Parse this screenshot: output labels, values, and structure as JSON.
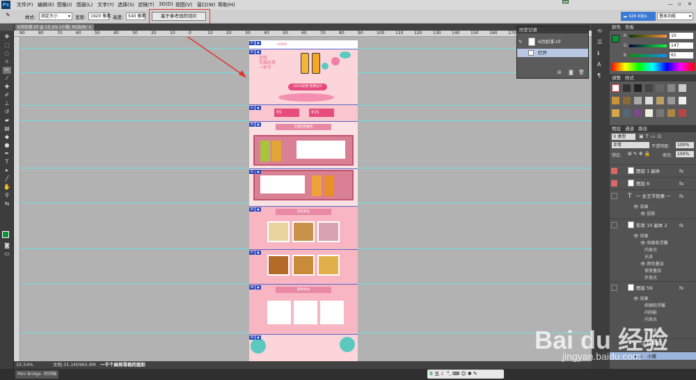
{
  "app": {
    "logo": "Ps"
  },
  "menu": [
    "文件(F)",
    "编辑(E)",
    "图像(I)",
    "图层(L)",
    "文字(Y)",
    "选择(S)",
    "滤镜(T)",
    "3D(D)",
    "视图(V)",
    "窗口(W)",
    "帮助(H)"
  ],
  "options": {
    "style_label": "样式:",
    "style_value": "固定大小",
    "width_label": "宽度:",
    "width_value": "1920 像素",
    "height_label": "高度:",
    "height_value": "540 像素",
    "slice_button": "基于参考线的切片"
  },
  "top_right": {
    "speed": "426 KB/s",
    "workspace": "基本功能"
  },
  "document": {
    "tab_title": "6月奶茶.tif @ 15.5% (小猪, RGB/8)",
    "zoom": "15.54%",
    "doc_info": "文档:31.1M/965.8M",
    "status_text": "一干个麻将哥格的面彩"
  },
  "ruler_numbers": [
    "90",
    "80",
    "70",
    "60",
    "50",
    "40",
    "30",
    "20",
    "10",
    "0",
    "10",
    "20",
    "30",
    "40",
    "50",
    "60",
    "70",
    "80",
    "90",
    "100",
    "110",
    "120",
    "130",
    "140",
    "150",
    "160",
    "170",
    "180",
    "190",
    "200"
  ],
  "canvas_text": {
    "logo": "LOGO",
    "hero_title": "定制\n专属奶茶\n一杯子",
    "hero_badge": "LOGO定制 免费设计",
    "coupon1": "¥5",
    "coupon2": "¥15",
    "section1": "店铺热销推荐",
    "section2": "热卖新品",
    "section3": "配件周边"
  },
  "history": {
    "title": "历史记录",
    "snapshot": "6月奶茶.tif",
    "open_step": "打开"
  },
  "color_panel": {
    "tabs": [
      "颜色",
      "色板"
    ],
    "r_label": "R",
    "r_value": "10",
    "g_label": "G",
    "g_value": "147",
    "b_label": "B",
    "b_value": "61",
    "fg_color": "#0a933d"
  },
  "styles_panel": {
    "tabs": [
      "调整",
      "样式"
    ]
  },
  "layers_panel": {
    "tabs": [
      "图层",
      "通道",
      "路径"
    ],
    "filter": "类型",
    "blend_mode": "正常",
    "opacity_label": "不透明度:",
    "opacity_value": "100%",
    "lock_label": "锁定:",
    "fill_label": "填充:",
    "fill_value": "100%",
    "layers": [
      {
        "name": "图层 1 副本"
      },
      {
        "name": "图层 6"
      },
      {
        "name": "一 女王节钜惠 一"
      },
      {
        "name": "效果"
      },
      {
        "name": "投影"
      },
      {
        "name": "形状 10 副本 2"
      },
      {
        "name": "效果"
      },
      {
        "name": "斜面和浮雕"
      },
      {
        "name": "内发光"
      },
      {
        "name": "光泽"
      },
      {
        "name": "颜色叠加"
      },
      {
        "name": "渐变叠加"
      },
      {
        "name": "外发光"
      },
      {
        "name": "图层 59"
      },
      {
        "name": "效果"
      },
      {
        "name": "斜面和浮雕"
      },
      {
        "name": "内阴影"
      },
      {
        "name": "内发光"
      },
      {
        "name": "颜色叠加"
      },
      {
        "name": "定制海报"
      },
      {
        "name": "小猪"
      }
    ]
  },
  "bottom_tabs": [
    "Mini Bridge",
    "时间轴"
  ],
  "watermark": {
    "brand": "Bai du 经验",
    "url": "jingyan.baidu.com"
  }
}
